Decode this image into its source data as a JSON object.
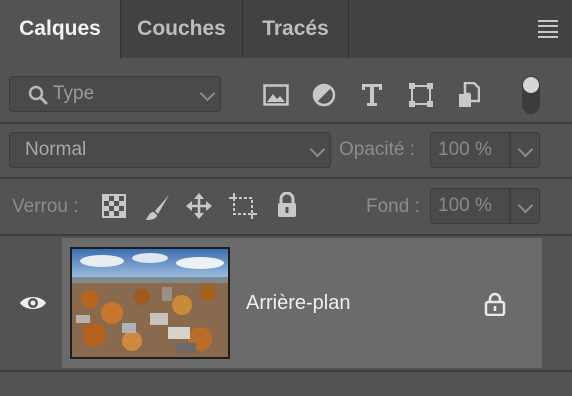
{
  "tabs": [
    {
      "label": "Calques",
      "active": true
    },
    {
      "label": "Couches",
      "active": false
    },
    {
      "label": "Tracés",
      "active": false
    }
  ],
  "filter": {
    "kind_value": "Type",
    "icons": [
      "image-filter-icon",
      "adjustment-filter-icon",
      "text-filter-icon",
      "shape-filter-icon",
      "smart-object-filter-icon",
      "filter-toggle-icon"
    ]
  },
  "blend": {
    "mode": "Normal",
    "opacity_label": "Opacité :",
    "opacity_value": "100 %"
  },
  "lock": {
    "label": "Verrou :",
    "fill_label": "Fond :",
    "fill_value": "100 %"
  },
  "layers": [
    {
      "name": "Arrière-plan",
      "visible": true,
      "locked": true
    }
  ],
  "colors": {
    "panel_bg": "#535353",
    "tab_bar_bg": "#424242",
    "selected_row": "#6b6b6b",
    "text": "#dcdcdc"
  }
}
